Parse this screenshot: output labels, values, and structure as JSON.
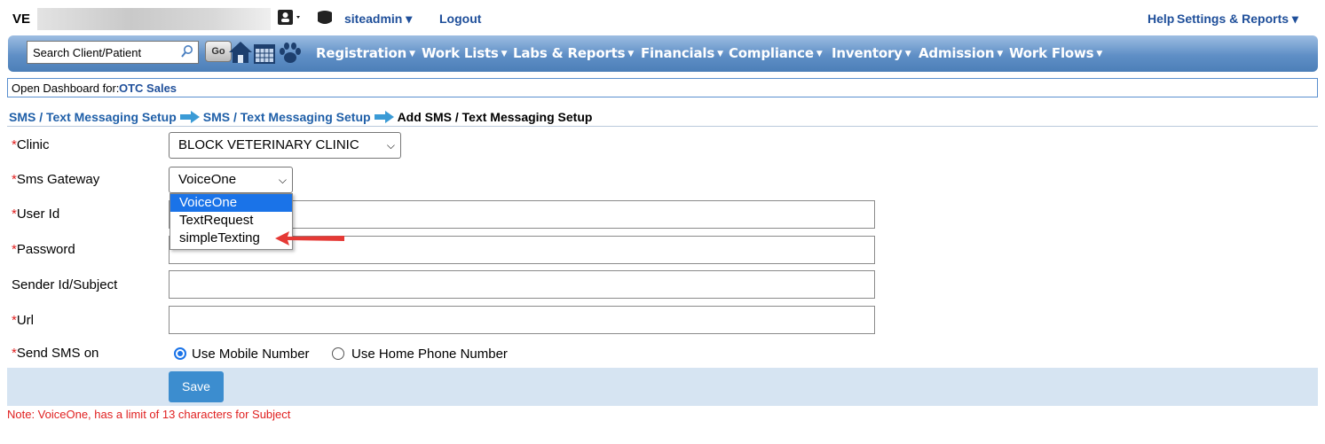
{
  "header": {
    "practice_prefix": "VE",
    "user": "siteadmin",
    "logout": "Logout",
    "help": "Help",
    "settings_reports": "Settings & Reports"
  },
  "nav": {
    "search_placeholder": "Search Client/Patient",
    "go_label": "Go",
    "menus": [
      "Registration",
      "Work Lists",
      "Labs & Reports",
      "Financials",
      "Compliance",
      "Inventory",
      "Admission",
      "Work Flows"
    ]
  },
  "dashboard": {
    "label": "Open Dashboard for:",
    "value": "OTC Sales"
  },
  "breadcrumb": {
    "items": [
      "SMS / Text Messaging Setup",
      "SMS / Text Messaging Setup"
    ],
    "current": "Add SMS / Text Messaging Setup"
  },
  "form": {
    "clinic": {
      "label": "Clinic",
      "value": "BLOCK VETERINARY CLINIC"
    },
    "gateway": {
      "label": "Sms Gateway",
      "value": "VoiceOne",
      "options": [
        "VoiceOne",
        "TextRequest",
        "simpleTexting"
      ]
    },
    "user_id": {
      "label": "User Id",
      "value": ""
    },
    "password": {
      "label": "Password",
      "value": ""
    },
    "sender": {
      "label": "Sender Id/Subject",
      "value": ""
    },
    "url": {
      "label": "Url",
      "value": ""
    },
    "send_on": {
      "label": "Send SMS on",
      "options": [
        "Use Mobile Number",
        "Use Home Phone Number"
      ],
      "selected": "Use Mobile Number"
    },
    "required_mark": "*",
    "save_label": "Save"
  },
  "note": "Note: VoiceOne, has a limit of 13 characters for Subject",
  "colors": {
    "link": "#1f4f9a",
    "nav": "#5f8fc6",
    "required": "#e02020",
    "highlight": "#1a73e8",
    "save": "#3c8dcf"
  }
}
